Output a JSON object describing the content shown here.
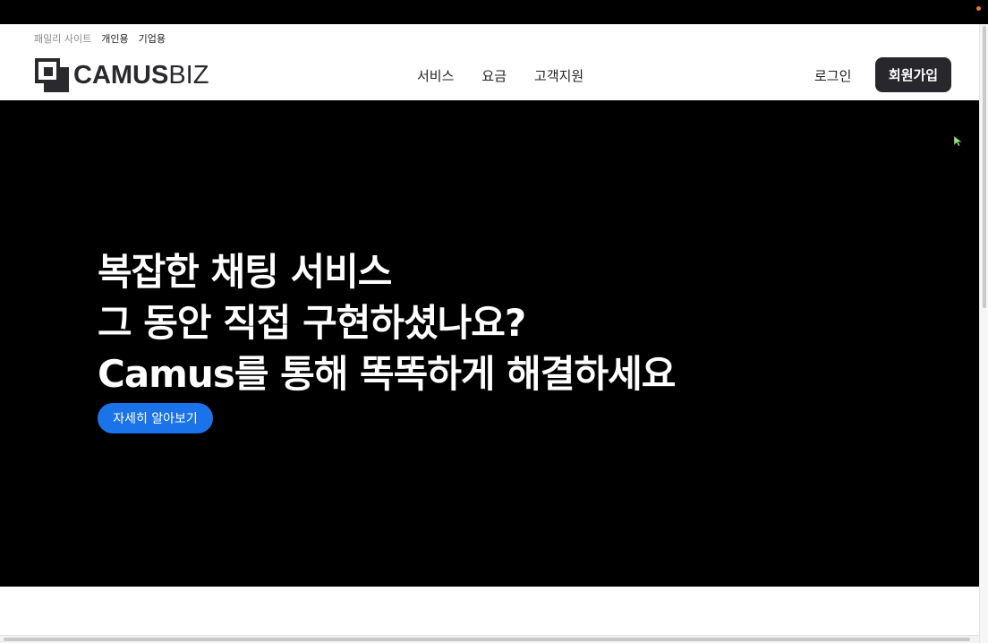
{
  "family_bar": {
    "label": "패밀리 사이트",
    "links": [
      "개인용",
      "기업용"
    ]
  },
  "logo": {
    "bold": "CAMUS",
    "light": "BIZ"
  },
  "nav": {
    "items": [
      "서비스",
      "요금",
      "고객지원"
    ]
  },
  "auth": {
    "login_label": "로그인",
    "signup_label": "회원가입"
  },
  "hero": {
    "lines": [
      "복잡한 채팅 서비스",
      "그 동안 직접 구현하셨나요?",
      "Camus를 통해 똑똑하게 해결하세요"
    ],
    "cta_label": "자세히 알아보기"
  },
  "colors": {
    "hero_bg": "#000000",
    "cta_blue": "#1a73e8",
    "signup_bg": "#27272c"
  }
}
